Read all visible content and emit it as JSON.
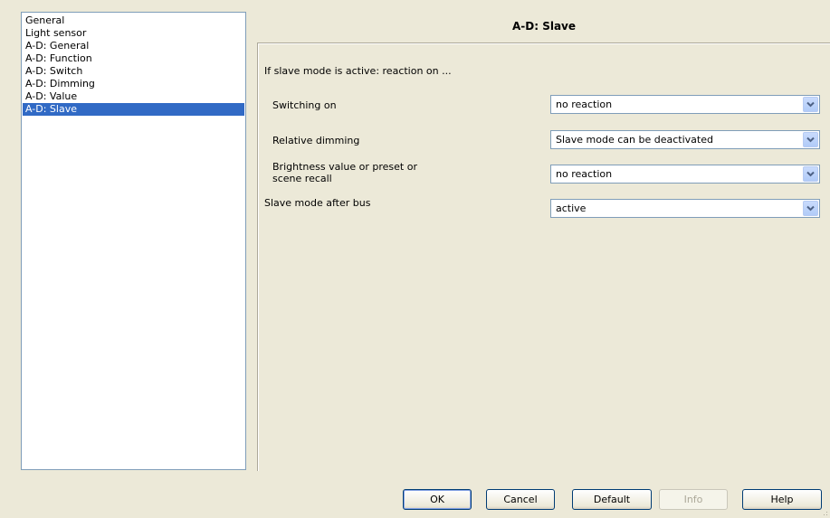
{
  "navigation": {
    "items": [
      {
        "label": "General"
      },
      {
        "label": "Light sensor"
      },
      {
        "label": "A-D: General"
      },
      {
        "label": "A-D: Function"
      },
      {
        "label": "A-D: Switch"
      },
      {
        "label": "A-D: Dimming"
      },
      {
        "label": "A-D: Value"
      },
      {
        "label": "A-D: Slave"
      }
    ],
    "selected": "A-D: Slave"
  },
  "page": {
    "title": "A-D: Slave",
    "section_header": "If slave mode is active: reaction on ...",
    "params": [
      {
        "label": "Switching on",
        "value": "no reaction"
      },
      {
        "label": "Relative dimming",
        "value": "Slave mode can be deactivated"
      },
      {
        "label_line1": "Brightness value or preset or",
        "label_line2": "scene recall",
        "value": "no reaction"
      },
      {
        "label": "Slave mode after bus",
        "value": "active"
      }
    ]
  },
  "buttons": {
    "ok": "OK",
    "cancel": "Cancel",
    "default": "Default",
    "info": "Info",
    "help": "Help"
  },
  "colors": {
    "selection": "#316ac5",
    "dialog_bg": "#ece9d8",
    "field_border": "#7f9db9"
  }
}
